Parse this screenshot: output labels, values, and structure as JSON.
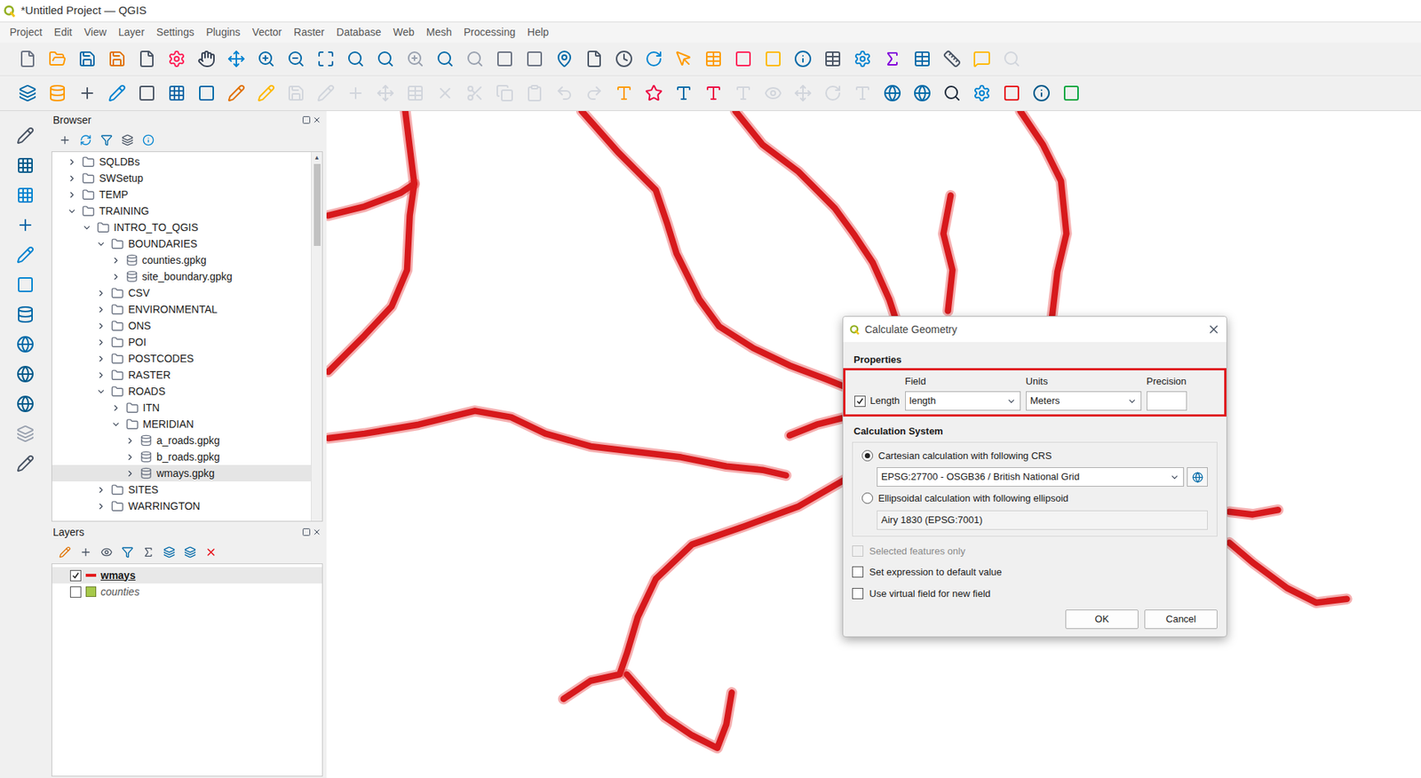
{
  "window": {
    "title": "*Untitled Project — QGIS"
  },
  "menu": [
    "Project",
    "Edit",
    "View",
    "Layer",
    "Settings",
    "Plugins",
    "Vector",
    "Raster",
    "Database",
    "Web",
    "Mesh",
    "Processing",
    "Help"
  ],
  "browser": {
    "title": "Browser",
    "items": [
      {
        "label": "SQLDBs",
        "depth": 0,
        "kind": "folder",
        "expanded": false,
        "selected": false
      },
      {
        "label": "SWSetup",
        "depth": 0,
        "kind": "folder",
        "expanded": false,
        "selected": false
      },
      {
        "label": "TEMP",
        "depth": 0,
        "kind": "folder",
        "expanded": false,
        "selected": false
      },
      {
        "label": "TRAINING",
        "depth": 0,
        "kind": "folder",
        "expanded": true,
        "selected": false
      },
      {
        "label": "INTRO_TO_QGIS",
        "depth": 1,
        "kind": "folder",
        "expanded": true,
        "selected": false
      },
      {
        "label": "BOUNDARIES",
        "depth": 2,
        "kind": "folder",
        "expanded": true,
        "selected": false
      },
      {
        "label": "counties.gpkg",
        "depth": 3,
        "kind": "gpkg",
        "expanded": false,
        "selected": false
      },
      {
        "label": "site_boundary.gpkg",
        "depth": 3,
        "kind": "gpkg",
        "expanded": false,
        "selected": false
      },
      {
        "label": "CSV",
        "depth": 2,
        "kind": "folder",
        "expanded": false,
        "selected": false
      },
      {
        "label": "ENVIRONMENTAL",
        "depth": 2,
        "kind": "folder",
        "expanded": false,
        "selected": false
      },
      {
        "label": "ONS",
        "depth": 2,
        "kind": "folder",
        "expanded": false,
        "selected": false
      },
      {
        "label": "POI",
        "depth": 2,
        "kind": "folder",
        "expanded": false,
        "selected": false
      },
      {
        "label": "POSTCODES",
        "depth": 2,
        "kind": "folder",
        "expanded": false,
        "selected": false
      },
      {
        "label": "RASTER",
        "depth": 2,
        "kind": "folder",
        "expanded": false,
        "selected": false
      },
      {
        "label": "ROADS",
        "depth": 2,
        "kind": "folder",
        "expanded": true,
        "selected": false
      },
      {
        "label": "ITN",
        "depth": 3,
        "kind": "folder",
        "expanded": false,
        "selected": false
      },
      {
        "label": "MERIDIAN",
        "depth": 3,
        "kind": "folder",
        "expanded": true,
        "selected": false
      },
      {
        "label": "a_roads.gpkg",
        "depth": 4,
        "kind": "gpkg",
        "expanded": false,
        "selected": false
      },
      {
        "label": "b_roads.gpkg",
        "depth": 4,
        "kind": "gpkg",
        "expanded": false,
        "selected": false
      },
      {
        "label": "wmays.gpkg",
        "depth": 4,
        "kind": "gpkg",
        "expanded": false,
        "selected": true
      },
      {
        "label": "SITES",
        "depth": 2,
        "kind": "folder",
        "expanded": false,
        "selected": false
      },
      {
        "label": "WARRINGTON",
        "depth": 2,
        "kind": "folder",
        "expanded": false,
        "selected": false
      }
    ]
  },
  "layers": {
    "title": "Layers",
    "items": [
      {
        "name": "wmays",
        "checked": true,
        "selected": true,
        "kind": "line",
        "color": "#e31a1c"
      },
      {
        "name": "counties",
        "checked": false,
        "selected": false,
        "kind": "polygon",
        "color": "#a6c94a"
      }
    ]
  },
  "dialog": {
    "title": "Calculate Geometry",
    "properties_label": "Properties",
    "length": {
      "checked": true,
      "label": "Length"
    },
    "headers": [
      "Field",
      "Units",
      "Precision"
    ],
    "field": "length",
    "units": "Meters",
    "precision": "",
    "calculation_label": "Calculation System",
    "options": [
      {
        "label": "Cartesian calculation with following CRS",
        "selected": true,
        "value": "EPSG:27700 - OSGB36 / British National Grid"
      },
      {
        "label": "Ellipsoidal calculation with following ellipsoid",
        "selected": false,
        "value": "Airy 1830 (EPSG:7001)"
      }
    ],
    "checkboxes": [
      {
        "label": "Selected features only",
        "checked": false,
        "disabled": true
      },
      {
        "label": "Set expression to default value",
        "checked": false,
        "disabled": false
      },
      {
        "label": "Use virtual field for new field",
        "checked": false,
        "disabled": false
      }
    ],
    "buttons": [
      "OK",
      "Cancel"
    ]
  }
}
